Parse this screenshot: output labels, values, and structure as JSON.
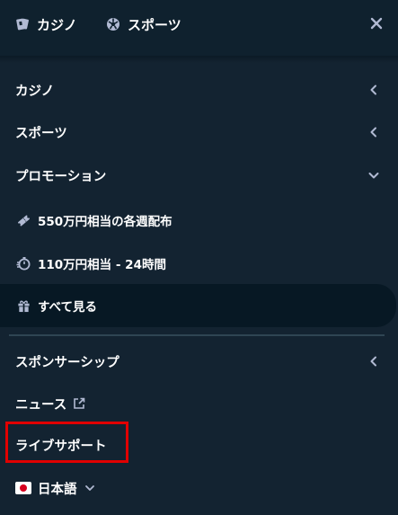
{
  "topbar": {
    "casino_label": "カジノ",
    "sports_label": "スポーツ"
  },
  "menu": {
    "casino": "カジノ",
    "sports": "スポーツ",
    "promotions": "プロモーション",
    "promo_weekly": "550万円相当の各週配布",
    "promo_race": "110万円相当 - 24時間",
    "view_all": "すべて見る",
    "sponsorship": "スポンサーシップ",
    "news": "ニュース",
    "live_support": "ライブサポート"
  },
  "language": {
    "selected": "日本語"
  },
  "colors": {
    "background": "#132331",
    "topbar": "#0f212e",
    "selected_row": "#071824",
    "highlight": "#e00000",
    "icon": "#b1bad3"
  }
}
